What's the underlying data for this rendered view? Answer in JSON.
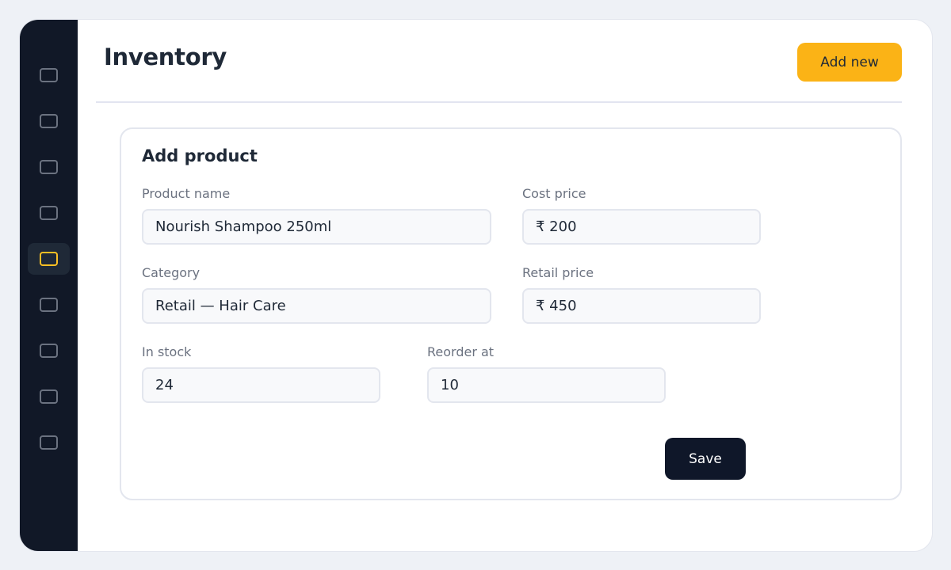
{
  "header": {
    "title": "Inventory",
    "add_new_label": "Add new"
  },
  "sidebar": {
    "active_index": 4,
    "items": [
      {
        "icon": "nav-icon",
        "active": false
      },
      {
        "icon": "nav-icon",
        "active": false
      },
      {
        "icon": "nav-icon",
        "active": false
      },
      {
        "icon": "nav-icon",
        "active": false
      },
      {
        "icon": "nav-icon",
        "active": true
      },
      {
        "icon": "nav-icon",
        "active": false
      },
      {
        "icon": "nav-icon",
        "active": false
      },
      {
        "icon": "nav-icon",
        "active": false
      },
      {
        "icon": "nav-icon",
        "active": false
      }
    ]
  },
  "form": {
    "title": "Add product",
    "product_name": {
      "label": "Product name",
      "value": "Nourish Shampoo 250ml"
    },
    "cost_price": {
      "label": "Cost price",
      "value": "₹ 200"
    },
    "category": {
      "label": "Category",
      "value": "Retail — Hair Care"
    },
    "retail_price": {
      "label": "Retail price",
      "value": "₹ 450"
    },
    "in_stock": {
      "label": "In stock",
      "value": "24"
    },
    "reorder_at": {
      "label": "Reorder at",
      "value": "10"
    },
    "save_label": "Save"
  },
  "colors": {
    "sidebar_bg": "#111827",
    "accent": "#fbb316",
    "primary_dark": "#0f1729",
    "page_bg": "#eef1f6"
  }
}
